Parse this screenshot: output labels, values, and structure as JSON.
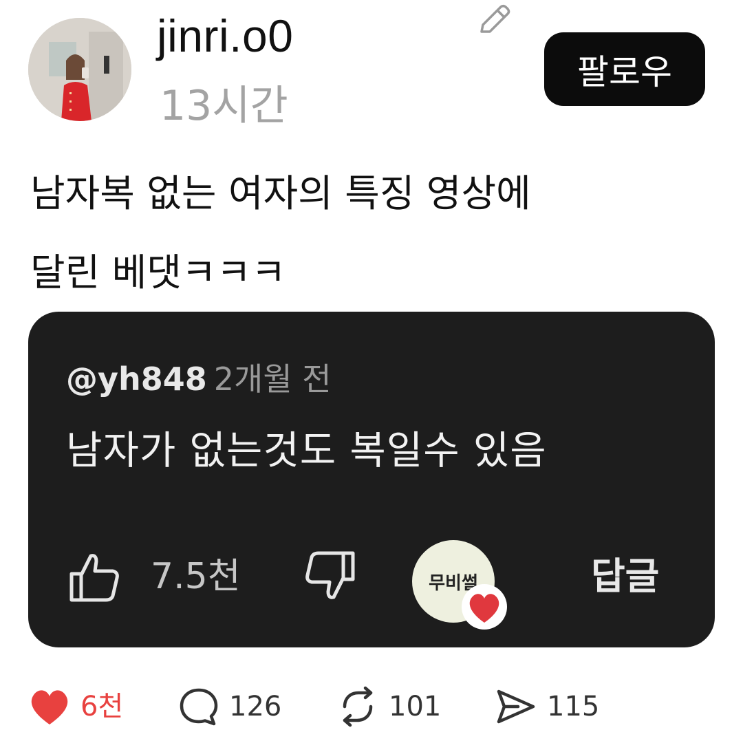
{
  "header": {
    "username": "jinri.o0",
    "time_ago": "13시간",
    "follow_label": "팔로우"
  },
  "post": {
    "text_line1": "남자복 없는 여자의 특징 영상에",
    "text_line2": "달린 베댓ㅋㅋㅋ"
  },
  "embedded_comment": {
    "handle": "@yh848",
    "time": "2개월 전",
    "body": "남자가 없는것도 복일수 있음",
    "like_count": "7.5천",
    "creator_label": "무비썰",
    "reply_label": "답글",
    "card_color": "#1d1d1d",
    "heart_color": "#e0383e"
  },
  "actions": {
    "likes": "6천",
    "comments": "126",
    "reposts": "101",
    "shares": "115",
    "like_color": "#e8413f"
  },
  "icons": [
    "edit-icon",
    "thumbs-up-icon",
    "thumbs-down-icon",
    "heart-icon",
    "comment-icon",
    "repost-icon",
    "share-icon"
  ]
}
